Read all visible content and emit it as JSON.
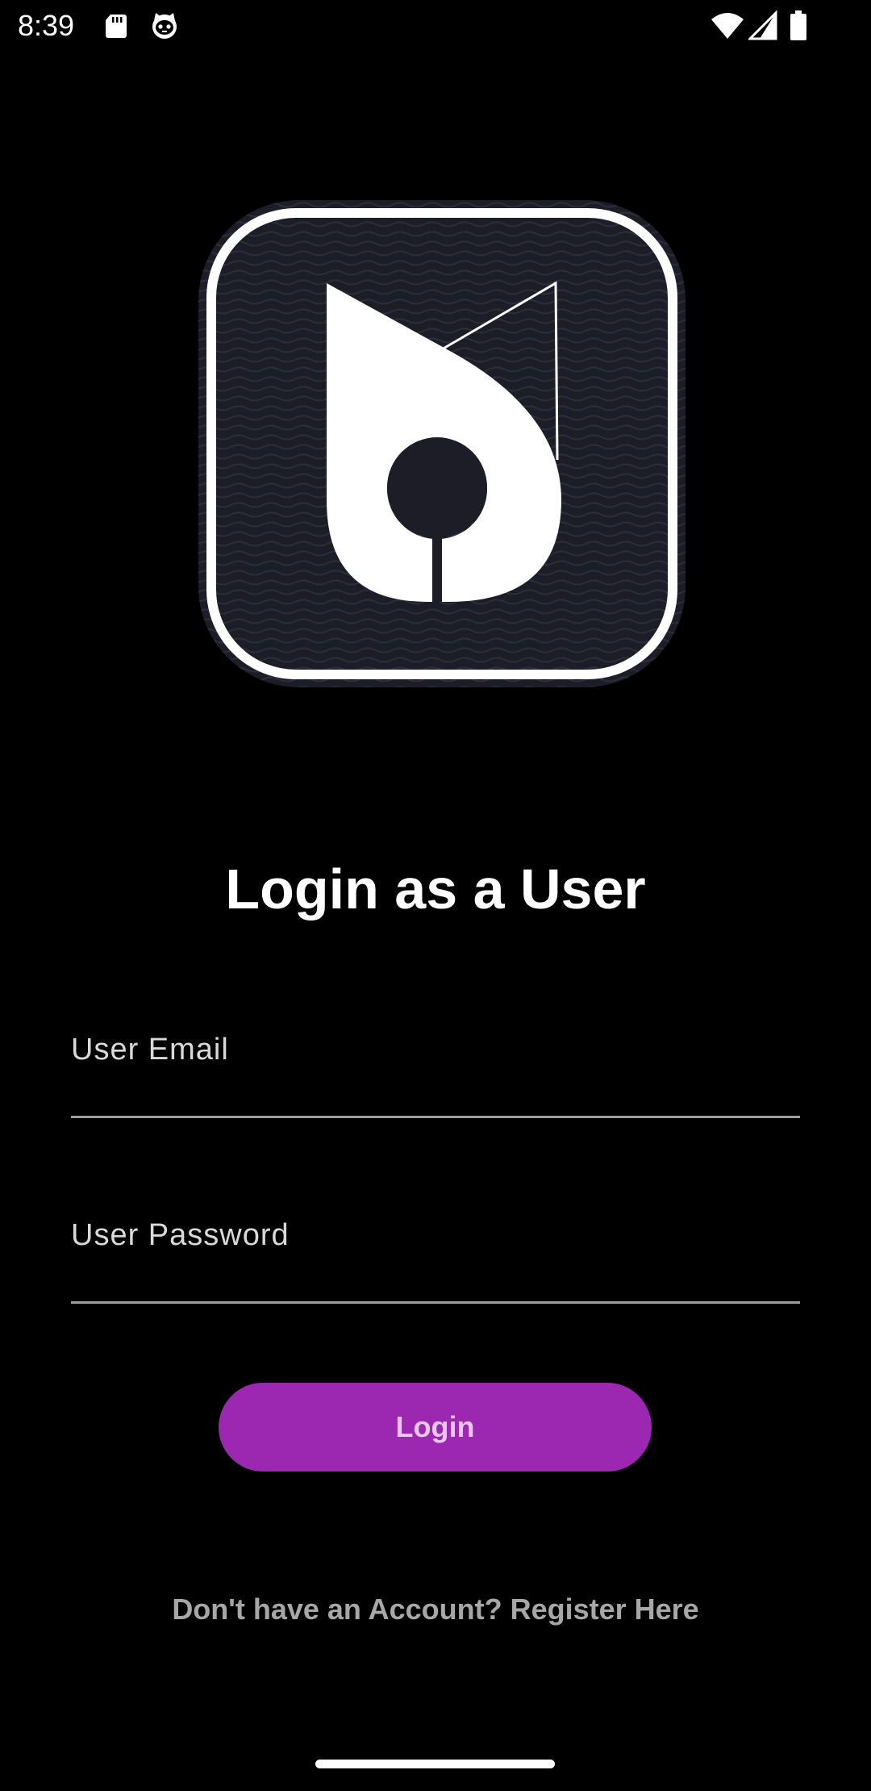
{
  "status_bar": {
    "time": "8:39",
    "left_icons": [
      "sd-card-icon",
      "cat-face-icon"
    ],
    "right_icons": [
      "wifi-icon",
      "cell-signal-icon",
      "battery-icon"
    ]
  },
  "logo": {
    "icon": "app-logo-icon",
    "colors": {
      "tile": "#1c1d27",
      "wave": "#2b2e3c",
      "border": "#ffffff",
      "mark": "#ffffff"
    }
  },
  "title": "Login as a User",
  "form": {
    "email_label": "User Email",
    "email_value": "",
    "password_label": "User Password",
    "password_value": "",
    "login_label": "Login"
  },
  "register_link": "Don't have an Account? Register Here",
  "colors": {
    "background": "#000000",
    "button": "#9c27b0",
    "button_text": "#e8c8ee",
    "label_text": "#d9d9d9",
    "underline": "#9e9e9e",
    "link_text": "#a7a7a7"
  }
}
